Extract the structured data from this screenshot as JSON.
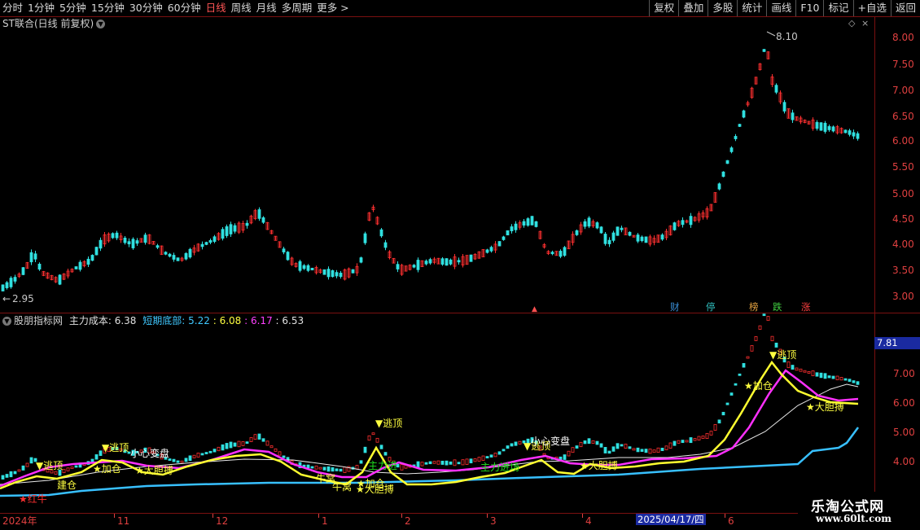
{
  "toolbar": {
    "periods": [
      "分时",
      "1分钟",
      "5分钟",
      "15分钟",
      "30分钟",
      "60分钟",
      "日线",
      "周线",
      "月线",
      "多周期",
      "更多 >"
    ],
    "active_period": "日线",
    "buttons": [
      "复权",
      "叠加",
      "多股",
      "统计",
      "画线",
      "F10",
      "标记",
      "+自选",
      "返回"
    ]
  },
  "price_panel": {
    "title": "ST联合(日线 前复权)",
    "high_marker": "8.10",
    "low_marker": "2.95",
    "axis_ticks": [
      "8.00",
      "7.50",
      "7.00",
      "6.50",
      "6.00",
      "5.50",
      "5.00",
      "4.50",
      "4.00",
      "3.50",
      "3.00"
    ],
    "badges": [
      {
        "text": "财",
        "color": "#3a8fd8"
      },
      {
        "text": "停",
        "color": "#30c0c0"
      },
      {
        "text": "榜",
        "color": "#e0a040"
      },
      {
        "text": "跌",
        "color": "#40d040"
      },
      {
        "text": "涨",
        "color": "#ff4040"
      }
    ]
  },
  "indicator_panel": {
    "name": "股朋指标网",
    "items": [
      {
        "label": "主力成本:",
        "value": "6.38",
        "color": "#e0e0e0"
      },
      {
        "label": "短期底部:",
        "value": "5.22",
        "color": "#40c8ff"
      },
      {
        "label": "",
        "value": "6.08",
        "color": "#ffff40"
      },
      {
        "label": "",
        "value": "6.17",
        "color": "#ff40ff"
      },
      {
        "label": "",
        "value": "6.53",
        "color": "#e0e0e0"
      }
    ],
    "current_value": "7.81",
    "axis_ticks": [
      "7.00",
      "6.00",
      "5.00",
      "4.00"
    ],
    "annotations": [
      {
        "text": "▼逃顶",
        "color": "#ffff40"
      },
      {
        "text": "▼逃顶",
        "color": "#ffff40"
      },
      {
        "text": "▼逃顶",
        "color": "#ffff40"
      },
      {
        "text": "▼逃顶",
        "color": "#ffff40"
      },
      {
        "text": "▼逃顶",
        "color": "#ffff40"
      },
      {
        "text": "★加仓",
        "color": "#ffff40"
      },
      {
        "text": "★加仓",
        "color": "#ffff40"
      },
      {
        "text": "★加仓",
        "color": "#ffff40"
      },
      {
        "text": "★大胆搏",
        "color": "#ffff40"
      },
      {
        "text": "★大胆搏",
        "color": "#ffff40"
      },
      {
        "text": "★大胆搏",
        "color": "#ffff40"
      },
      {
        "text": "★大胆搏",
        "color": "#ffff40"
      },
      {
        "text": "小心变盘",
        "color": "#ffffff"
      },
      {
        "text": "小心变盘",
        "color": "#ffffff"
      },
      {
        "text": "建仓",
        "color": "#ffff40"
      },
      {
        "text": "牛窝",
        "color": "#ffff40"
      },
      {
        "text": "牛窝",
        "color": "#ffff40"
      },
      {
        "text": "★红牛",
        "color": "#ff3030"
      },
      {
        "text": "主力进",
        "color": "#20e020"
      },
      {
        "text": "主力进场",
        "color": "#20e020"
      }
    ]
  },
  "date_axis": {
    "labels": [
      "2024年",
      "11",
      "12",
      "1",
      "2",
      "3",
      "4",
      "2025/04/17/四",
      "6"
    ]
  },
  "watermark": {
    "title": "乐淘公式网",
    "url": "www.60lt.com"
  }
}
